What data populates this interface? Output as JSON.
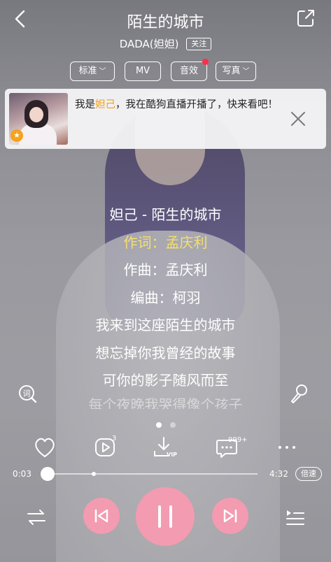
{
  "song": {
    "title": "陌生的城市",
    "artist": "DADA(妲妲)",
    "follow_label": "关注"
  },
  "options": [
    {
      "label": "标准",
      "has_dropdown": true
    },
    {
      "label": "MV",
      "has_dropdown": false
    },
    {
      "label": "音效",
      "has_dropdown": false,
      "red_dot": true
    },
    {
      "label": "写真",
      "has_dropdown": true
    }
  ],
  "banner": {
    "text_before": "我是",
    "highlight": "妲己",
    "text_after": "，我在酷狗直播开播了，快来看吧！",
    "badge": "★"
  },
  "lyrics": {
    "lines": [
      "妲己 - 陌生的城市",
      "作词：孟庆利",
      "作曲：孟庆利",
      "编曲：柯羽",
      "我来到这座陌生的城市",
      "想忘掉你我曾经的故事",
      "可你的影子随风而至",
      "每个夜晚我哭得像个孩子"
    ],
    "active_index": 1
  },
  "pager": {
    "pages": 2,
    "current": 1
  },
  "actions": {
    "share_count": "3",
    "comment_count": "999+",
    "download_badge": "VIP"
  },
  "progress": {
    "current": "0:03",
    "total": "4:32",
    "fraction": 0.011,
    "speed_label": "倍速"
  },
  "colors": {
    "accent_pink": "#f39bb0",
    "highlight_yellow": "#f5df6e",
    "banner_orange": "#f0a117",
    "notify_red": "#ff2d4b"
  }
}
